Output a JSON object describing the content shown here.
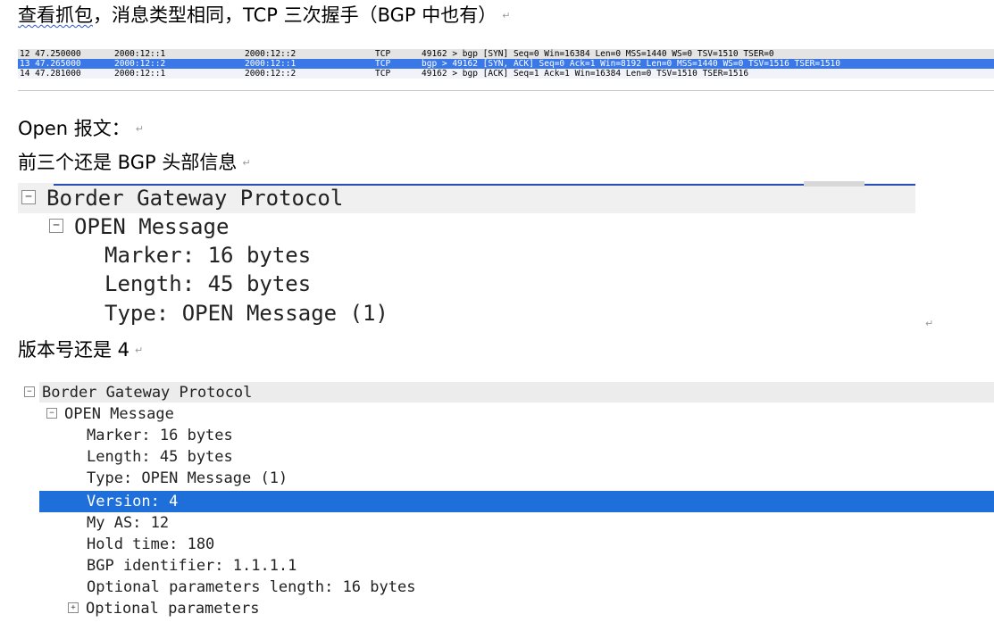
{
  "notes": {
    "line1_prefix": "查看抓包",
    "line1_rest": "，消息类型相同，TCP 三次握手（BGP 中也有）",
    "line2": "Open 报文：",
    "line3": "前三个还是 BGP 头部信息",
    "line4": "版本号还是 4",
    "para_mark": "↵"
  },
  "packets": [
    {
      "no_time": "12 47.250000",
      "src": "2000:12::1",
      "dst": "2000:12::2",
      "proto": "TCP",
      "info": "49162 > bgp [SYN] Seq=0 Win=16384 Len=0 MSS=1440 WS=0 TSV=1510 TSER=0"
    },
    {
      "no_time": "13 47.265000",
      "src": "2000:12::2",
      "dst": "2000:12::1",
      "proto": "TCP",
      "info": "bgp > 49162 [SYN, ACK] Seq=0 Ack=1 Win=8192 Len=0 MSS=1440 WS=0 TSV=1516 TSER=1510"
    },
    {
      "no_time": "14 47.281000",
      "src": "2000:12::1",
      "dst": "2000:12::2",
      "proto": "TCP",
      "info": "49162 > bgp [ACK] Seq=1 Ack=1 Win=16384 Len=0 TSV=1510 TSER=1516"
    }
  ],
  "tree1": {
    "protocol": "Border Gateway Protocol",
    "message": "OPEN Message",
    "marker": "Marker: 16 bytes",
    "length": "Length: 45 bytes",
    "type": "Type: OPEN Message (1)"
  },
  "tree2": {
    "protocol": "Border Gateway Protocol",
    "message": "OPEN Message",
    "marker": "Marker: 16 bytes",
    "length": "Length: 45 bytes",
    "type": "Type: OPEN Message (1)",
    "version": "Version: 4",
    "my_as": "My AS: 12",
    "hold_time": "Hold time: 180",
    "bgp_id": "BGP identifier: 1.1.1.1",
    "opt_len": "Optional parameters length: 16 bytes",
    "opt_params": "Optional parameters"
  },
  "toggles": {
    "collapse": "−",
    "expand": "+"
  },
  "colors": {
    "selected_row": "#3b78e7",
    "selected_tree": "#1e6fd9"
  }
}
